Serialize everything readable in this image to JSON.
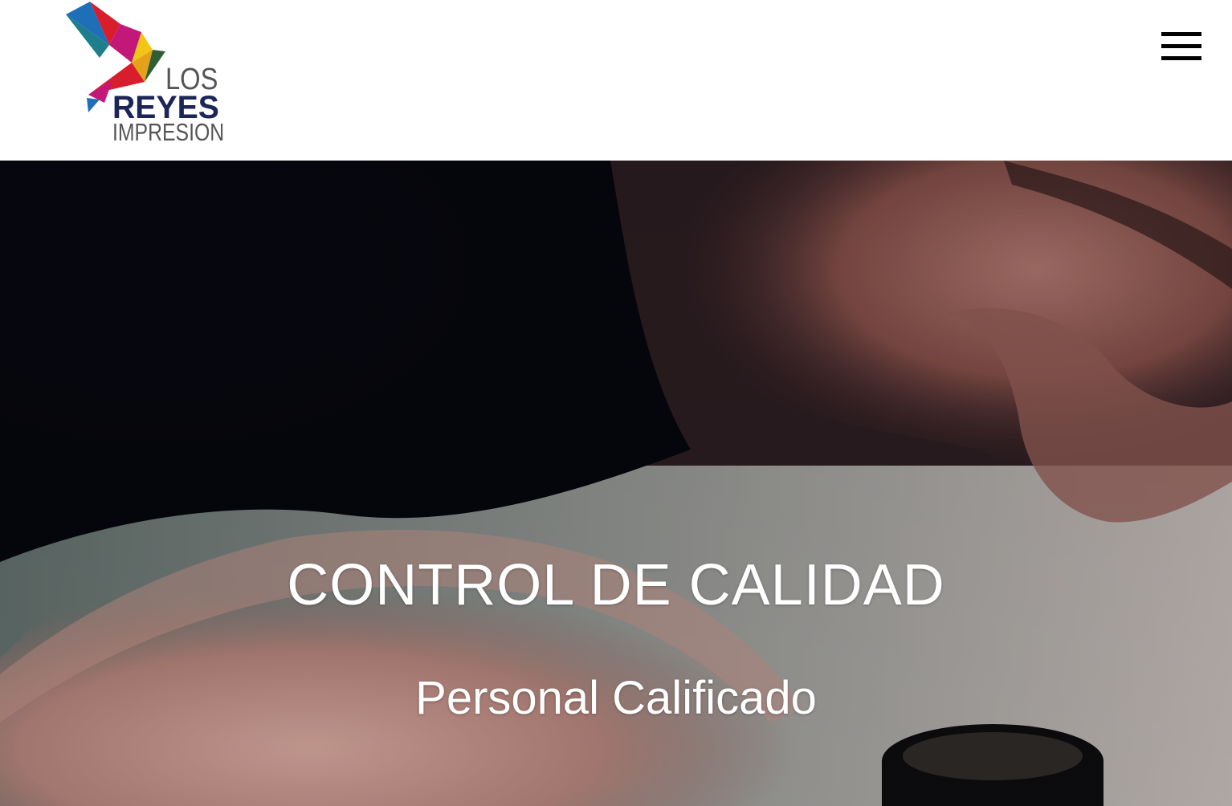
{
  "header": {
    "logo": {
      "line1": "LOS",
      "line2": "REYES",
      "line3": "IMPRESION",
      "colors": {
        "navy": "#1c2557",
        "gray": "#555555",
        "red": "#d81e2c",
        "magenta": "#c2187a",
        "blue": "#1d6fb8",
        "yellow": "#f2c516",
        "green": "#2f5f33",
        "teal": "#1e7f8c"
      }
    },
    "menu_icon": "hamburger-icon"
  },
  "hero": {
    "title": "CONTROL DE CALIDAD",
    "subtitle": "Personal Calificado",
    "image": "quality-inspector-with-loupe"
  }
}
